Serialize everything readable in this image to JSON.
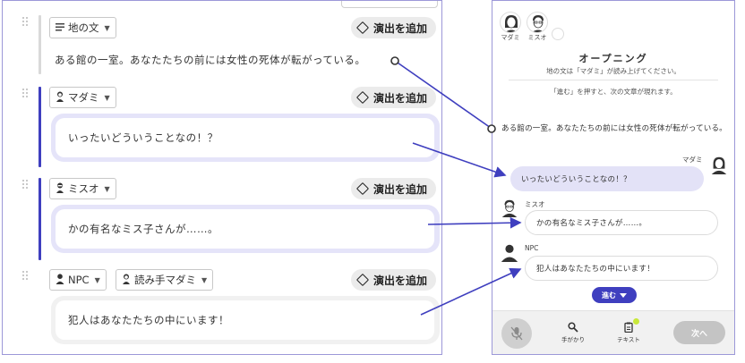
{
  "editor": {
    "add_effect_label": "演出を追加",
    "blocks": [
      {
        "type": "narration",
        "chip_label": "地の文",
        "text": "ある館の一室。あなたたちの前には女性の死体が転がっている。"
      },
      {
        "type": "dialogue",
        "chip_label": "マダミ",
        "text": "いったいどういうことなの！？"
      },
      {
        "type": "dialogue",
        "chip_label": "ミスオ",
        "text": "かの有名なミス子さんが……。"
      },
      {
        "type": "dialogue",
        "chip_label": "NPC",
        "chip2_label": "読み手マダミ",
        "text": "犯人はあなたたちの中にいます！"
      }
    ]
  },
  "preview": {
    "avatars": [
      {
        "name": "マダミ"
      },
      {
        "name": "ミスオ"
      }
    ],
    "opening": {
      "title": "オープニング",
      "line1": "地の文は「マダミ」が読み上げてください。",
      "line2": "「進む」を押すと、次の文章が現れます。"
    },
    "narration": "ある館の一室。あなたたちの前には女性の死体が転がっている。",
    "messages": [
      {
        "speaker": "マダミ",
        "text": "いったいどういうことなの！？"
      },
      {
        "speaker": "ミスオ",
        "text": "かの有名なミス子さんが……。"
      },
      {
        "speaker": "NPC",
        "text": "犯人はあなたたちの中にいます！"
      }
    ],
    "advance_label": "進む",
    "tools": {
      "clue_label": "手がかり",
      "text_label": "テキスト"
    },
    "next_label": "次へ"
  },
  "colors": {
    "accent": "#3f3fbf",
    "bubble_tint": "#e5e4f9",
    "badge": "#c8e83a"
  }
}
